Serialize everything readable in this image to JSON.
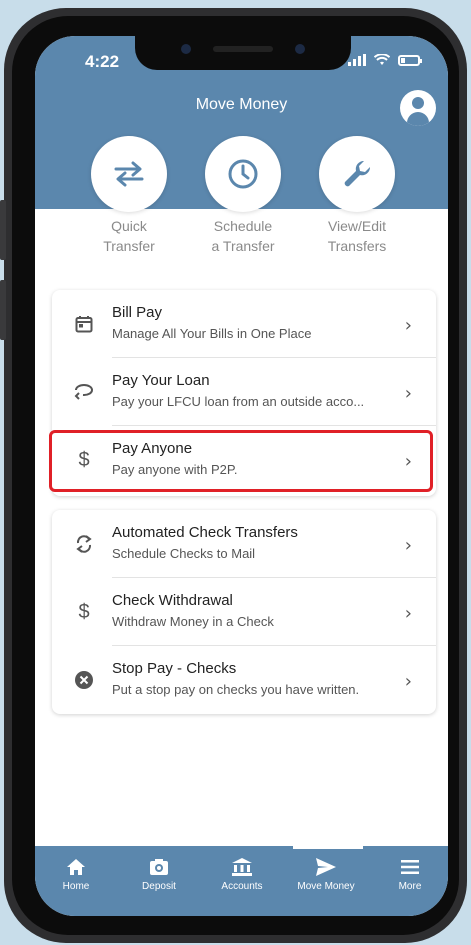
{
  "status_bar": {
    "time": "4:22"
  },
  "header": {
    "title": "Move Money"
  },
  "quick_actions": [
    {
      "line1": "Quick",
      "line2": "Transfer",
      "icon": "swap-arrows-icon"
    },
    {
      "line1": "Schedule",
      "line2": "a Transfer",
      "icon": "clock-icon"
    },
    {
      "line1": "View/Edit",
      "line2": "Transfers",
      "icon": "wrench-icon"
    }
  ],
  "payments": [
    {
      "title": "Bill Pay",
      "subtitle": "Manage All Your Bills in One Place",
      "icon": "calendar-icon"
    },
    {
      "title": "Pay Your Loan",
      "subtitle": "Pay your LFCU loan from an outside acco...",
      "icon": "loan-hand-icon"
    },
    {
      "title": "Pay Anyone",
      "subtitle": "Pay anyone with P2P.",
      "icon": "dollar-icon"
    }
  ],
  "checks": [
    {
      "title": "Automated Check Transfers",
      "subtitle": "Schedule Checks to Mail",
      "icon": "refresh-icon"
    },
    {
      "title": "Check Withdrawal",
      "subtitle": "Withdraw Money in a Check",
      "icon": "dollar-icon"
    },
    {
      "title": "Stop Pay - Checks",
      "subtitle": "Put a stop pay on checks you have written.",
      "icon": "cancel-circle-icon"
    }
  ],
  "tabbar": {
    "items": [
      {
        "label": "Home",
        "icon": "home-icon"
      },
      {
        "label": "Deposit",
        "icon": "camera-icon"
      },
      {
        "label": "Accounts",
        "icon": "bank-icon"
      },
      {
        "label": "Move Money",
        "icon": "send-icon"
      },
      {
        "label": "More",
        "icon": "menu-icon"
      }
    ],
    "active": "Move Money"
  },
  "colors": {
    "brand": "#5b87ad",
    "highlight": "#e02027"
  }
}
